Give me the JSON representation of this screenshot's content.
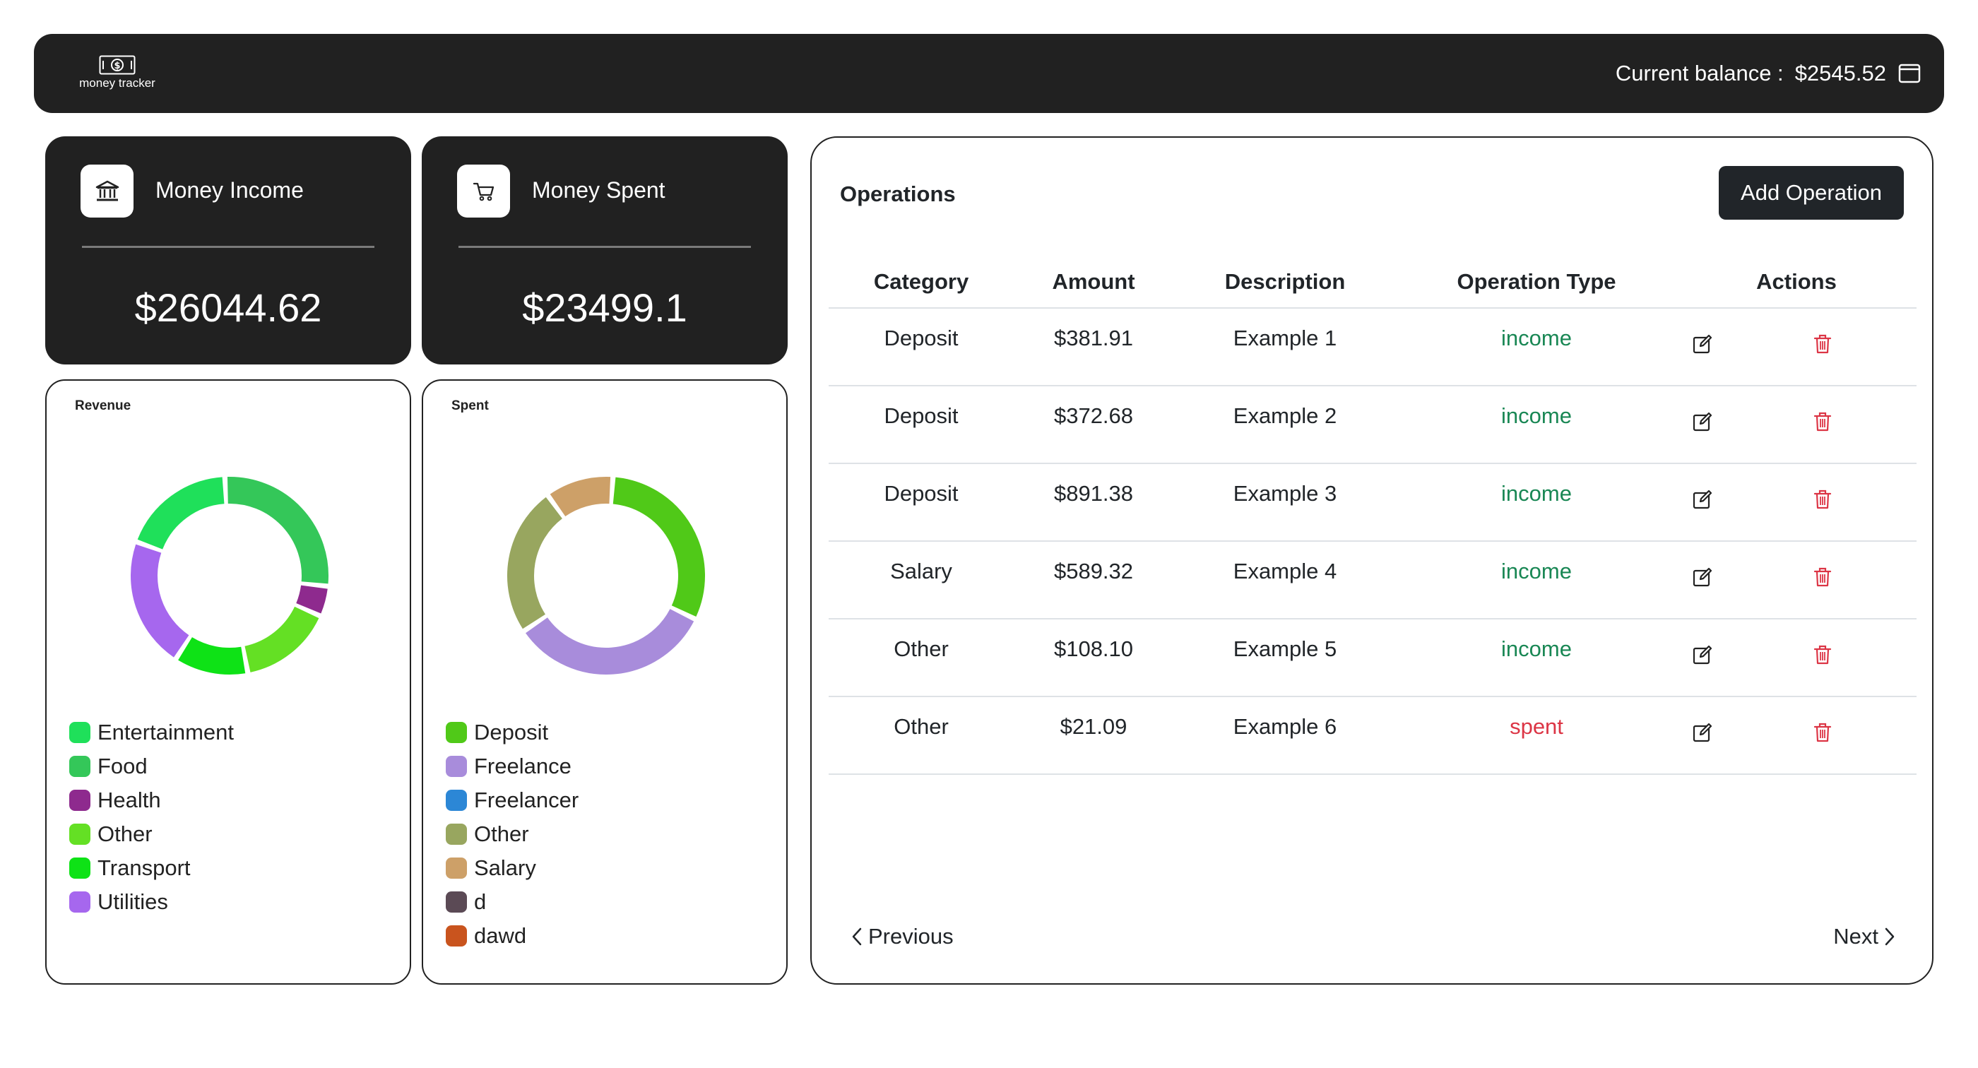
{
  "header": {
    "logo_text": "money tracker",
    "balance_label": "Current balance :",
    "balance_value": "$2545.52"
  },
  "stats": {
    "income": {
      "title": "Money Income",
      "value": "$26044.62",
      "icon": "bank-icon"
    },
    "spent": {
      "title": "Money Spent",
      "value": "$23499.1",
      "icon": "cart-icon"
    }
  },
  "charts": {
    "revenue": {
      "title": "Revenue",
      "items": [
        {
          "label": "Entertainment",
          "color": "#1fe05a",
          "fraction": 0.17
        },
        {
          "label": "Food",
          "color": "#34c759",
          "fraction": 0.25
        },
        {
          "label": "Health",
          "color": "#8e2a8e",
          "fraction": 0.045
        },
        {
          "label": "Other",
          "color": "#64e024",
          "fraction": 0.14
        },
        {
          "label": "Transport",
          "color": "#0ee216",
          "fraction": 0.11
        },
        {
          "label": "Utilities",
          "color": "#a667ee",
          "fraction": 0.195
        }
      ]
    },
    "spent": {
      "title": "Spent",
      "items": [
        {
          "label": "Deposit",
          "color": "#50c918",
          "fraction": 0.28
        },
        {
          "label": "Freelance",
          "color": "#a88cdb",
          "fraction": 0.3
        },
        {
          "label": "Freelancer",
          "color": "#2c87d6",
          "fraction": 0.0
        },
        {
          "label": "Other",
          "color": "#98a65f",
          "fraction": 0.22
        },
        {
          "label": "Salary",
          "color": "#cda068",
          "fraction": 0.1
        },
        {
          "label": "d",
          "color": "#5b4a55",
          "fraction": 0.0
        },
        {
          "label": "dawd",
          "color": "#c9541e",
          "fraction": 0.0
        }
      ]
    }
  },
  "operations": {
    "title": "Operations",
    "add_label": "Add Operation",
    "columns": [
      "Category",
      "Amount",
      "Description",
      "Operation Type",
      "Actions"
    ],
    "rows": [
      {
        "category": "Deposit",
        "amount": "$381.91",
        "description": "Example 1",
        "type": "income"
      },
      {
        "category": "Deposit",
        "amount": "$372.68",
        "description": "Example 2",
        "type": "income"
      },
      {
        "category": "Deposit",
        "amount": "$891.38",
        "description": "Example 3",
        "type": "income"
      },
      {
        "category": "Salary",
        "amount": "$589.32",
        "description": "Example 4",
        "type": "income"
      },
      {
        "category": "Other",
        "amount": "$108.10",
        "description": "Example 5",
        "type": "income"
      },
      {
        "category": "Other",
        "amount": "$21.09",
        "description": "Example 6",
        "type": "spent"
      }
    ],
    "previous_label": "Previous",
    "next_label": "Next"
  }
}
